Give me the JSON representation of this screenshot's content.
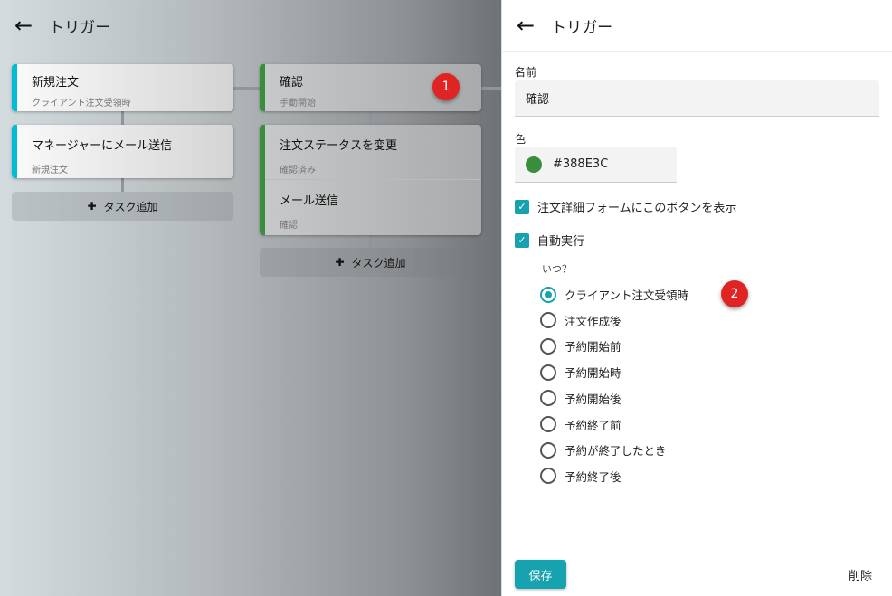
{
  "header": {
    "title": "トリガー"
  },
  "columns": [
    {
      "color": "#00BCD4",
      "trigger": {
        "title": "新規注文",
        "subtitle": "クライアント注文受領時"
      },
      "tasks": [
        {
          "title": "マネージャーにメール送信",
          "subtitle": "新規注文"
        }
      ],
      "add_label": "タスク追加"
    },
    {
      "color": "#388E3C",
      "trigger": {
        "title": "確認",
        "subtitle": "手動開始"
      },
      "tasks": [
        {
          "title": "注文ステータスを変更",
          "subtitle": "確認済み"
        },
        {
          "title": "メール送信",
          "subtitle": "確認"
        }
      ],
      "add_label": "タスク追加"
    }
  ],
  "badges": [
    "1",
    "2"
  ],
  "panel": {
    "title": "トリガー",
    "name_label": "名前",
    "name_value": "確認",
    "color_label": "色",
    "color_value": "#388E3C",
    "show_button_label": "注文詳細フォームにこのボタンを表示",
    "show_button_checked": true,
    "auto_run_label": "自動実行",
    "auto_run_checked": true,
    "when_label": "いつ？",
    "options": [
      "クライアント注文受領時",
      "注文作成後",
      "予約開始前",
      "予約開始時",
      "予約開始後",
      "予約終了前",
      "予約が終了したとき",
      "予約終了後"
    ],
    "selected": "クライアント注文受領時",
    "save_label": "保存",
    "delete_label": "削除"
  }
}
